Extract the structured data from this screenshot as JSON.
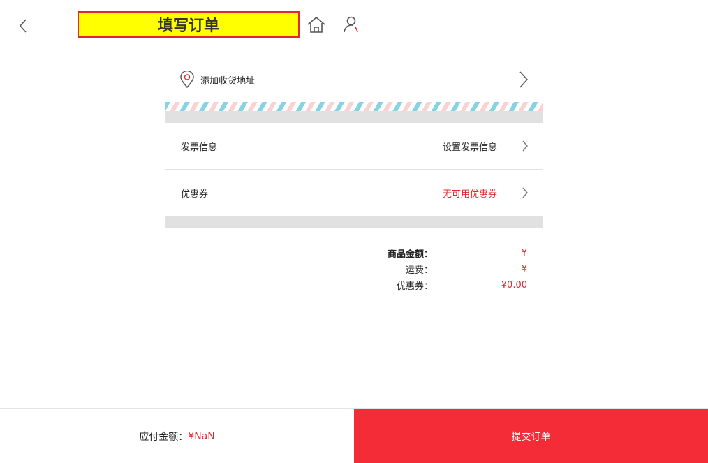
{
  "header": {
    "title": "填写订单"
  },
  "address": {
    "label": "添加收货地址"
  },
  "invoice": {
    "label": "发票信息",
    "value": "设置发票信息",
    "value_color": "#222222"
  },
  "coupon": {
    "label": "优惠券",
    "value": "无可用优惠券",
    "value_color": "#e0282e"
  },
  "summary": {
    "goods_label": "商品金额：",
    "goods_value": "¥",
    "shipping_label": "运费：",
    "shipping_value": "¥",
    "coupon_label": "优惠券：",
    "coupon_value": "¥0.00"
  },
  "footer": {
    "pay_label": "应付金额：",
    "pay_amount": "¥NaN",
    "submit_label": "提交订单"
  },
  "colors": {
    "accent": "#f42c38",
    "title_bg": "#ffff00",
    "price": "#e0282e"
  },
  "icons": {
    "back": "chevron-left-icon",
    "home": "home-icon",
    "user": "user-icon",
    "location": "location-pin-icon",
    "arrow": "chevron-right-icon"
  }
}
